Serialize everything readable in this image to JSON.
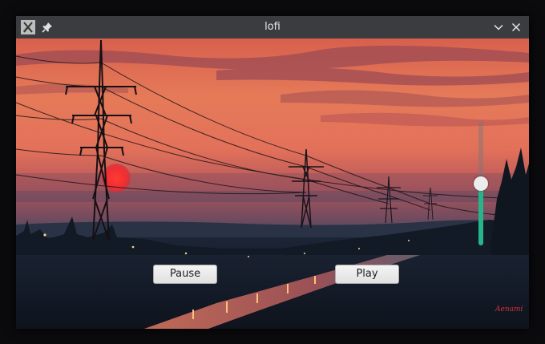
{
  "window": {
    "title": "lofi",
    "app_icon": "app-x-icon",
    "pin_icon": "pin-icon",
    "minimize_icon": "chevron-down-icon",
    "close_icon": "close-icon"
  },
  "controls": {
    "pause_label": "Pause",
    "play_label": "Play"
  },
  "volume": {
    "level": 0.5,
    "accent_color": "#26b58b"
  },
  "background": {
    "signature_text": "Aenami"
  }
}
